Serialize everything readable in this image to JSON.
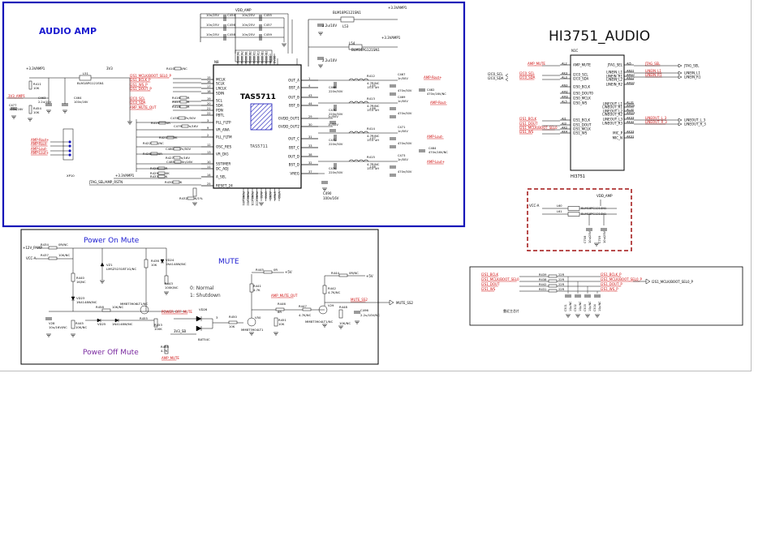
{
  "titles": {
    "audio_amp": "AUDIO AMP",
    "hi3751_audio": "HI3751_AUDIO",
    "power_on_mute": "Power On Mute",
    "mute": "MUTE",
    "power_off_mute": "Power Off Mute"
  },
  "amp": {
    "chip_name": "TAS5711",
    "chip_under": "TAS5711",
    "ref": "N8",
    "left_pins": [
      {
        "num": "15",
        "label": "MCLK"
      },
      {
        "num": "16",
        "label": "SCLK"
      },
      {
        "num": "17",
        "label": "LRCLK"
      },
      {
        "num": "18",
        "label": "SDIN"
      },
      {
        "num": "19",
        "label": "SCL"
      },
      {
        "num": "20",
        "label": "SDA"
      },
      {
        "num": "21",
        "label": "PDN"
      },
      {
        "num": "22",
        "label": "PBTL"
      },
      {
        "num": "3",
        "label": "PLL_FLTP"
      },
      {
        "num": "9",
        "label": "VR_ANA"
      },
      {
        "num": "2",
        "label": "PLL_FLTM"
      },
      {
        "num": "12",
        "label": "OSC_RES"
      },
      {
        "num": "13",
        "label": "VR_DIG"
      },
      {
        "num": "10",
        "label": "SSTIMER"
      },
      {
        "num": "11",
        "label": "DC_ADJ"
      },
      {
        "num": "14",
        "label": "A_SEL"
      },
      {
        "num": "25",
        "label": "RESET_24"
      }
    ],
    "right_pins": [
      {
        "num": "1",
        "label": "OUT_A"
      },
      {
        "num": "4",
        "label": "BST_A"
      },
      {
        "num": "43",
        "label": "OUT_B"
      },
      {
        "num": "44",
        "label": "BST_B"
      },
      {
        "num": "29",
        "label": "GVDD_OUT1"
      },
      {
        "num": "30",
        "label": "GVDD_OUT2"
      },
      {
        "num": "31",
        "label": "OUT_C"
      },
      {
        "num": "33",
        "label": "BST_C"
      },
      {
        "num": "38",
        "label": "OUT_D"
      },
      {
        "num": "32",
        "label": "BST_D"
      },
      {
        "num": "37",
        "label": "VREG"
      }
    ],
    "top_pins": [
      "PVDD_A1",
      "PVDD_A2",
      "PVDD_B1",
      "PVDD_B2",
      "PVDD_C1",
      "PVDD_C2",
      "PVDD_D1",
      "PVDD_D2",
      "AVDD",
      "DVDD"
    ],
    "bottom_pins": [
      "PGND_AB1",
      "PGND_AB2",
      "PGND_CD1",
      "PGND_CD2",
      "AVSS",
      "DVSS",
      "AGND",
      "STEST",
      "VFSD"
    ],
    "left_nets": [
      "I2S1_MCLK/BOOT_SEL0_P",
      "I2S1_BCLK_P",
      "I2S1_WS_P",
      "I2S1_DOUT_P",
      "I2C0_SCL",
      "I2C0_SDA",
      "AMP_MUTE_OUT"
    ],
    "left_parts": [
      "R410",
      "R416",
      "R417",
      "R418",
      "C478",
      "R419",
      "C479",
      "R421",
      "R422",
      "C480",
      "R426",
      "R427",
      "C485",
      "R428",
      "R429",
      "R430",
      "R432",
      "R433"
    ],
    "left_values": [
      "0R/NC",
      "22R",
      "22R",
      "22R",
      "4.7n/50V",
      "470R",
      "47n/16V",
      "3.3K",
      "0R/NC",
      "4.7n/50V",
      "220R",
      "47n/16V",
      "100n/16V",
      "22R",
      "100K",
      "18K",
      "10K/1%",
      "10K"
    ],
    "reset_net": "JTAG_SEL/AMP_RSTN",
    "supply_net": "+3.3VAMP1",
    "vdd_amp": "VDD_AMP",
    "top_caps": [
      "10n/25V",
      "10n/25V",
      "10n/25V",
      "10n/25V",
      "10n/25V",
      "10n/25V"
    ],
    "top_cap_refs": [
      "C454",
      "C455",
      "C456",
      "C457",
      "C458",
      "C459"
    ],
    "bead": "BLM18PG121SN1",
    "bead_refs": [
      "L53",
      "L54"
    ],
    "cap_2u2": "2.2u/10V",
    "bead_supply": "+3.3VAMP1",
    "out_nets": [
      "AMP-Rout+",
      "AMP-Rout-",
      "AMP-Lout-",
      "AMP-Lout+"
    ],
    "out_parts": [
      "R412",
      "R413",
      "R414",
      "R415",
      "L55",
      "L56",
      "L57",
      "L58",
      "C467",
      "C468",
      "C469",
      "C470",
      "C471",
      "C472",
      "C473",
      "C474",
      "C475",
      "C476",
      "C477",
      "C481",
      "C482",
      "C483",
      "C484",
      "C486"
    ],
    "out_values": [
      "4.7R/NC",
      "15.0 uH",
      "1n/50V",
      "470n/50V",
      "220n/50V",
      "470n/16V/NC",
      "33n/50V",
      "1u/50V"
    ],
    "vreg_cap": "C490",
    "vreg_val": "100n/16V",
    "left_conn_ref": "XP10",
    "left_conn_nets": [
      "AMP-Rout+",
      "AMP-Rout-",
      "AMP-Lout-",
      "AMP-Lout+"
    ],
    "input_net": "3V3_AMP1",
    "input_parts": [
      "R411",
      "C463",
      "C464",
      "L51",
      "R454",
      "C477"
    ],
    "input_values": [
      "10K",
      "2.2u/10V",
      "100n/16V",
      "BLM18PG121SN1",
      "10K",
      "100n/16V"
    ],
    "pvcc_net": "3V3",
    "sl_net": "+3.3VAMP1"
  },
  "hi3751": {
    "ref": "N1C",
    "chip": "HI3751",
    "left_pins": [
      {
        "ball": "AL2",
        "label": "AMP_MUTE",
        "net": "AMP_MUTE"
      },
      {
        "ball": "AK3",
        "label": "I2C0_SCL",
        "net": "I2C0_SCL"
      },
      {
        "ball": "AL3",
        "label": "I2C0_SDA",
        "net": "I2C0_SDA"
      },
      {
        "ball": "AN3",
        "label": "I2S0_BCLK",
        "net": ""
      },
      {
        "ball": "AM2",
        "label": "I2S0_DOUT0",
        "net": ""
      },
      {
        "ball": "AM3",
        "label": "I2S0_MCLK",
        "net": ""
      },
      {
        "ball": "AL5",
        "label": "I2S0_WS",
        "net": ""
      },
      {
        "ball": "AJ1",
        "label": "I2S1_BCLK",
        "net": "I2S1_BCLK"
      },
      {
        "ball": "AJ3",
        "label": "I2S1_DOUT",
        "net": "I2S1_DOUT"
      },
      {
        "ball": "AK2",
        "label": "I2S1_MCLK",
        "net": "I2S1_MCLK/BOOT_SEL0"
      },
      {
        "ball": "AK4",
        "label": "I2S1_WS",
        "net": "I2S1_WS"
      }
    ],
    "right_pins": [
      {
        "ball": "AJ5",
        "label": "JTAG_SEL",
        "net": "JTAG_SEL"
      },
      {
        "ball": "AN31",
        "label": "LINEIN_L1",
        "net": "LINEIN_L1"
      },
      {
        "ball": "AM31",
        "label": "LINEIN_R1",
        "net": "LINEIN_R1"
      },
      {
        "ball": "AN32",
        "label": "LINEIN_L2",
        "net": ""
      },
      {
        "ball": "AM32",
        "label": "LINEIN_R2",
        "net": ""
      },
      {
        "ball": "AL31",
        "label": "LINEOUT_L1",
        "net": ""
      },
      {
        "ball": "AM30",
        "label": "LINEOUT_R1",
        "net": ""
      },
      {
        "ball": "AL32",
        "label": "LINEOUT_L2",
        "net": ""
      },
      {
        "ball": "AM33",
        "label": "LINEOUT_R2",
        "net": ""
      },
      {
        "ball": "AK33",
        "label": "LINEOUT_L3",
        "net": "LINEOUT_L_3"
      },
      {
        "ball": "AK32",
        "label": "LINEOUT_R3",
        "net": "LINEOUT_R_3"
      },
      {
        "ball": "AK33",
        "label": "MIC_P",
        "net": ""
      },
      {
        "ball": "AK31",
        "label": "MIC_N",
        "net": ""
      }
    ],
    "i2c_left": [
      "I2C0_SCL",
      "I2C0_SDA"
    ]
  },
  "vdd_block": {
    "vcc_net": "VCC-A",
    "vdd_amp": "VDD_AMP",
    "beads": [
      "BLM18PG121SN1",
      "BLM18PG121SN1"
    ],
    "bead_refs": [
      "L60",
      "L61"
    ],
    "caps": [
      "C708",
      "C709"
    ],
    "cap_vals": [
      "10u/25V",
      "10u/25V"
    ]
  },
  "power_on_mute": {
    "nets": [
      "+12V_PAMP",
      "VCC-A"
    ],
    "parts": [
      "R434",
      "R437",
      "R440",
      "VZ1",
      "VD23",
      "R443",
      "R436",
      "VD24",
      "R447",
      "VZ10",
      "VD25",
      "C500",
      "R458",
      "V28",
      "R445",
      "R455",
      "R453"
    ],
    "values": [
      "0R/NC",
      "10K/NC",
      "1K/NC",
      "LMSZ5231BT1G/NC",
      "1N4148W/NC",
      "100K/NC",
      "10K",
      "1N4148W/NC",
      "1N4148W/NC",
      "10u/16V/NC",
      "10K/NC",
      "MMBT3906LT1/NC",
      "10K/NC",
      "100K",
      "4.7K"
    ],
    "legend_0": "0: Normal",
    "legend_1": "1: Shutdown",
    "power_off_net": "POWER_OFF_MUTE",
    "v3_net": "3V3_SB",
    "bat_part": "BAT54C",
    "vd_ref": "VD26",
    "amp_mute": "AMP_MUTE"
  },
  "mute_block": {
    "parts": [
      "R450",
      "R445",
      "R441",
      "V50",
      "R446",
      "R451",
      "R447",
      "R442",
      "V29",
      "R448",
      "C496",
      "R444"
    ],
    "values": [
      "10K",
      "0R",
      "4.7K",
      "MMBT3904LT1",
      "8R",
      "10K",
      "4.7K/NC",
      "4.7K/NC",
      "MMBT3904LT1/NC",
      "10K/NC",
      "2.2u/10V/NC",
      "0R/NC"
    ],
    "supply": "+5V",
    "supply2": "+5V",
    "amp_mute_out": "AMP_MUTE_OUT",
    "mute_out": "MUTE_SS2"
  },
  "i2s_block": {
    "left_nets": [
      "I2S1_BCLK",
      "I2S1_MCLK/BOOT_SEL0",
      "I2S1_DOUT",
      "I2S1_WS"
    ],
    "resistors": [
      "R439",
      "R438",
      "R442",
      "R431"
    ],
    "res_vals": [
      "22R",
      "22R",
      "22R",
      "22R"
    ],
    "right_nets": [
      "I2S1_BCLK_P",
      "I2S1_MCLK/BOOT_SEL0_P",
      "I2S1_DOUT_P",
      "I2S1_WS_P"
    ],
    "caps": [
      "C501",
      "C502",
      "C503",
      "C504"
    ],
    "cap_vals": [
      "10p/NC",
      "10p/NC",
      "10p/NC",
      "10p/NC"
    ],
    "note": "靠近主芯片",
    "out_net": "I2S1_MCLK/BOOT_SEL0_P"
  },
  "colors": {
    "frame_blue": "#1515b8",
    "title_blue": "#1a1ad0",
    "red": "#d01010",
    "dark_red": "#a01010",
    "line": "#000000",
    "title_purple": "#7a2aa0"
  }
}
